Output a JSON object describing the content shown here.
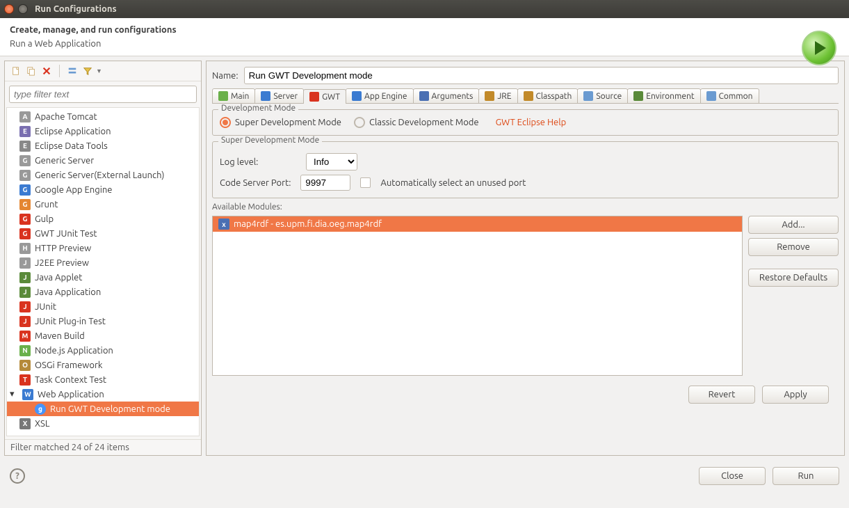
{
  "window": {
    "title": "Run Configurations"
  },
  "header": {
    "title": "Create, manage, and run configurations",
    "subtitle": "Run a Web Application"
  },
  "filter": {
    "placeholder": "type filter text"
  },
  "tree": {
    "items": [
      {
        "label": "Apache Tomcat"
      },
      {
        "label": "Eclipse Application"
      },
      {
        "label": "Eclipse Data Tools"
      },
      {
        "label": "Generic Server"
      },
      {
        "label": "Generic Server(External Launch)"
      },
      {
        "label": "Google App Engine"
      },
      {
        "label": "Grunt"
      },
      {
        "label": "Gulp"
      },
      {
        "label": "GWT JUnit Test"
      },
      {
        "label": "HTTP Preview"
      },
      {
        "label": "J2EE Preview"
      },
      {
        "label": "Java Applet"
      },
      {
        "label": "Java Application"
      },
      {
        "label": "JUnit"
      },
      {
        "label": "JUnit Plug-in Test"
      },
      {
        "label": "Maven Build"
      },
      {
        "label": "Node.js Application"
      },
      {
        "label": "OSGi Framework"
      },
      {
        "label": "Task Context Test"
      },
      {
        "label": "Web Application",
        "expanded": true,
        "children": [
          {
            "label": "Run GWT Development mode",
            "selected": true
          }
        ]
      },
      {
        "label": "XSL"
      }
    ],
    "status": "Filter matched 24 of 24 items"
  },
  "form": {
    "name_label": "Name:",
    "name_value": "Run GWT Development mode",
    "tabs": [
      "Main",
      "Server",
      "GWT",
      "App Engine",
      "Arguments",
      "JRE",
      "Classpath",
      "Source",
      "Environment",
      "Common"
    ],
    "active_tab": "GWT",
    "devmode": {
      "legend": "Development Mode",
      "super_label": "Super Development Mode",
      "classic_label": "Classic Development Mode",
      "help": "GWT Eclipse Help"
    },
    "sdm": {
      "legend": "Super Development Mode",
      "log_label": "Log level:",
      "log_value": "Info",
      "port_label": "Code Server Port:",
      "port_value": "9997",
      "auto_label": "Automatically select an unused port"
    },
    "modules": {
      "legend": "Available Modules:",
      "items": [
        "map4rdf - es.upm.fi.dia.oeg.map4rdf"
      ],
      "add": "Add...",
      "remove": "Remove",
      "restore": "Restore Defaults"
    },
    "revert": "Revert",
    "apply": "Apply"
  },
  "footer": {
    "close": "Close",
    "run": "Run"
  }
}
